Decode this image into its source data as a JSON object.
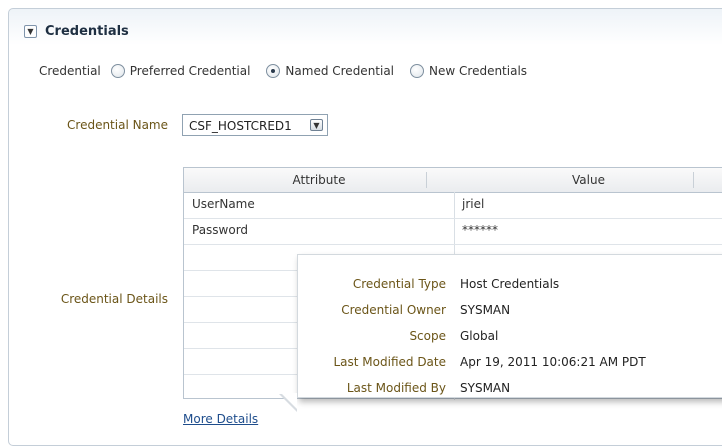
{
  "section": {
    "title": "Credentials",
    "collapse_icon": "chevron-down-icon"
  },
  "credential": {
    "label": "Credential",
    "options": [
      "Preferred Credential",
      "Named Credential",
      "New Credentials"
    ],
    "selected": "Named Credential"
  },
  "credential_name": {
    "label": "Credential Name",
    "value": "CSF_HOSTCRED1",
    "dropdown_icon": "chevron-down-icon"
  },
  "credential_details": {
    "label": "Credential Details",
    "columns": [
      "Attribute",
      "Value"
    ],
    "rows": [
      {
        "attribute": "UserName",
        "value": "jriel"
      },
      {
        "attribute": "Password",
        "value": "******"
      }
    ],
    "more_link": "More Details"
  },
  "popup": {
    "items": [
      {
        "label": "Credential Type",
        "value": "Host Credentials"
      },
      {
        "label": "Credential Owner",
        "value": "SYSMAN"
      },
      {
        "label": "Scope",
        "value": "Global"
      },
      {
        "label": "Last Modified Date",
        "value": "Apr 19, 2011 10:06:21 AM PDT"
      },
      {
        "label": "Last Modified By",
        "value": "SYSMAN"
      }
    ]
  },
  "colors": {
    "accent_label": "#6b5518",
    "link": "#1e4d8c",
    "border": "#b9c4cf"
  }
}
